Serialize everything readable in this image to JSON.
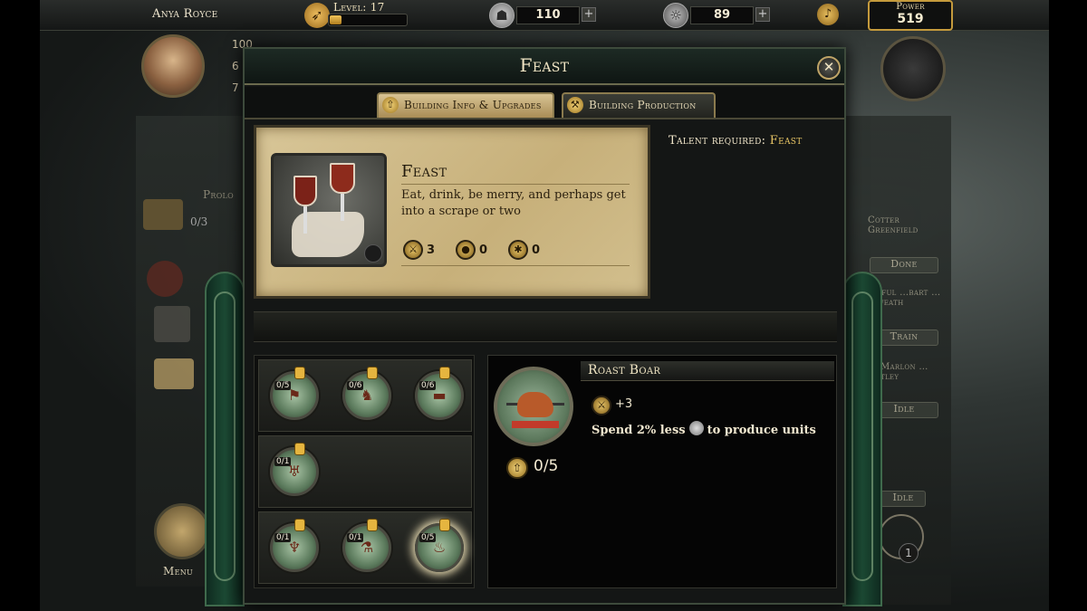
{
  "topbar": {
    "player_name": "Anya Royce",
    "level_label": "Level:",
    "level_value": "17",
    "level_progress": 0.15,
    "silver": "110",
    "gold": "89",
    "power_label": "Power",
    "power_value": "519"
  },
  "side_stats": {
    "stat1": "100",
    "stat2": "6",
    "stat3": "7"
  },
  "background": {
    "left_quest_partial": "Prolo",
    "left_count": "0/3",
    "menu_label": "Menu",
    "right_item1_name": "Cotter Greenfield",
    "right_item1_button": "Done",
    "right_item2_name": "…pful …bart …ryweath",
    "right_item2_button": "Train",
    "right_item3_name": "Marlon …tley",
    "right_item3_button": "Idle",
    "right_item4_button": "Idle",
    "right_badge": "1"
  },
  "window": {
    "title": "Feast",
    "close_glyph": "✕",
    "tabs": [
      {
        "label": "Building Info & Upgrades",
        "active": true
      },
      {
        "label": "Building Production",
        "active": false
      }
    ]
  },
  "building": {
    "name": "Feast",
    "description": "Eat, drink, be merry, and perhaps get into a scrape or two",
    "stats": [
      {
        "icon": "sword-icon",
        "value": "3"
      },
      {
        "icon": "coin-pouch-icon",
        "value": "0"
      },
      {
        "icon": "spider-icon",
        "value": "0"
      }
    ],
    "talent_label": "Talent required:",
    "talent_value": "Feast"
  },
  "upgrades": {
    "rows": [
      [
        {
          "count": "0/5",
          "locked": true
        },
        {
          "count": "0/6",
          "locked": true
        },
        {
          "count": "0/6",
          "locked": true
        }
      ],
      [
        {
          "count": "0/1",
          "locked": true
        }
      ],
      [
        {
          "count": "0/1",
          "locked": true
        },
        {
          "count": "0/1",
          "locked": true
        },
        {
          "count": "0/5",
          "locked": true,
          "selected": true
        }
      ]
    ]
  },
  "detail": {
    "title": "Roast Boar",
    "bonus_value": "+3",
    "effect_pre": "Spend 2% less",
    "effect_post": "to produce units",
    "level": "0/5"
  },
  "colors": {
    "accent_gold": "#c49a3c",
    "parchment": "#d2bf8e",
    "frame_green": "#1c4a34"
  }
}
